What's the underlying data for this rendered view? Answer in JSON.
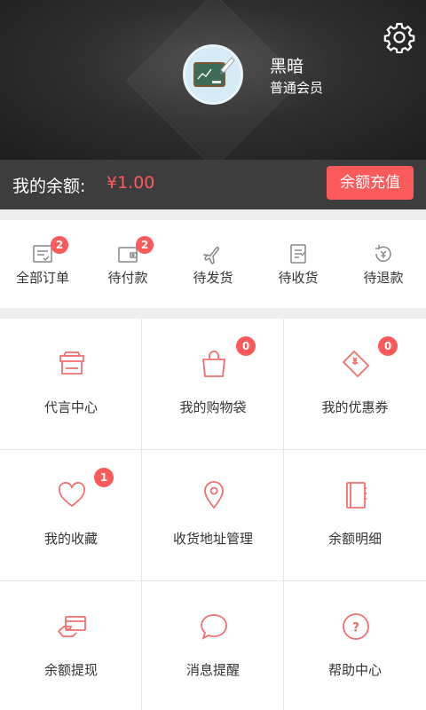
{
  "profile": {
    "name": "黑暗",
    "level": "普通会员",
    "avatar_icon": "avatar-icon",
    "settings_icon": "gear-icon"
  },
  "balance": {
    "label": "我的余额:",
    "value": "¥1.00",
    "recharge_label": "余额充值"
  },
  "orders": [
    {
      "label": "全部订单",
      "icon": "all-orders-icon",
      "badge": "2"
    },
    {
      "label": "待付款",
      "icon": "wallet-icon",
      "badge": "2"
    },
    {
      "label": "待发货",
      "icon": "plane-icon",
      "badge": ""
    },
    {
      "label": "待收货",
      "icon": "receipt-icon",
      "badge": ""
    },
    {
      "label": "待退款",
      "icon": "refund-icon",
      "badge": ""
    }
  ],
  "grid": [
    {
      "label": "代言中心",
      "icon": "shop-icon",
      "badge": ""
    },
    {
      "label": "我的购物袋",
      "icon": "shopping-bag-icon",
      "badge": "0"
    },
    {
      "label": "我的优惠券",
      "icon": "coupon-icon",
      "badge": "0"
    },
    {
      "label": "我的收藏",
      "icon": "heart-icon",
      "badge": "1"
    },
    {
      "label": "收货地址管理",
      "icon": "location-icon",
      "badge": ""
    },
    {
      "label": "余额明细",
      "icon": "notebook-icon",
      "badge": ""
    },
    {
      "label": "余额提现",
      "icon": "card-hand-icon",
      "badge": ""
    },
    {
      "label": "消息提醒",
      "icon": "message-icon",
      "badge": ""
    },
    {
      "label": "帮助中心",
      "icon": "help-icon",
      "badge": ""
    }
  ],
  "colors": {
    "accent": "#fa5a5a",
    "header_bg": "#2e2e2e",
    "balance_bg": "#3d3d3d",
    "icon_color": "#f07070",
    "order_icon_color": "#888888"
  }
}
